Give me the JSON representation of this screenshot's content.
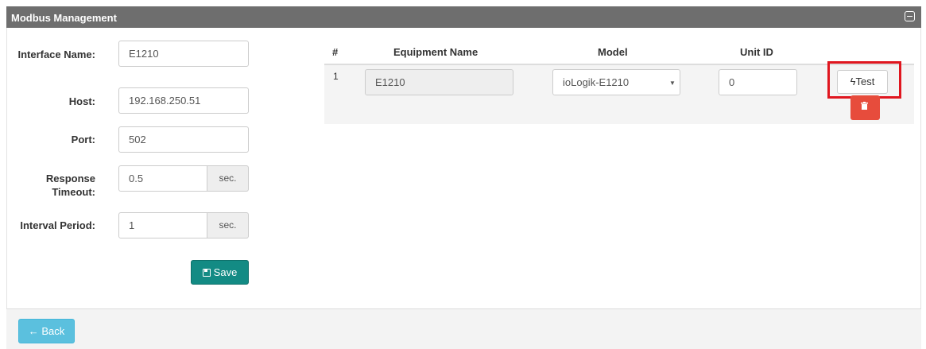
{
  "header": {
    "title": "Modbus Management",
    "collapse_icon": "collapse-icon"
  },
  "form": {
    "interface_name": {
      "label": "Interface Name:",
      "value": "E1210"
    },
    "host": {
      "label": "Host:",
      "value": "192.168.250.51"
    },
    "port": {
      "label": "Port:",
      "value": "502"
    },
    "response_timeout": {
      "label": "Response Timeout:",
      "value": "0.5",
      "unit": "sec."
    },
    "interval_period": {
      "label": "Interval Period:",
      "value": "1",
      "unit": "sec."
    },
    "save_label": "Save",
    "save_icon": "floppy-disk-icon"
  },
  "table": {
    "headers": [
      "#",
      "Equipment Name",
      "Model",
      "Unit ID"
    ],
    "rows": [
      {
        "index": "1",
        "equipment_name": "E1210",
        "model": "ioLogik-E1210",
        "unit_id": "0",
        "test_label": "Test",
        "test_icon": "lightning-bolt-icon",
        "delete_icon": "trash-icon"
      }
    ]
  },
  "footer": {
    "back_label": "Back",
    "back_icon": "arrow-left-icon"
  },
  "colors": {
    "header_bg": "#6e6e6e",
    "save_bg": "#138b84",
    "delete_bg": "#e74c3c",
    "back_bg": "#5bc0de",
    "highlight": "#e0161f"
  }
}
